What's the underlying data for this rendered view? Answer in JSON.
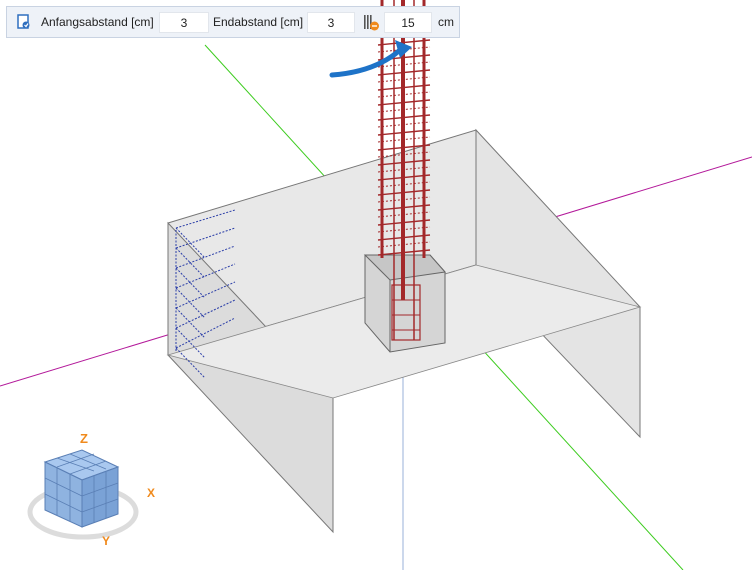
{
  "toolbar": {
    "start_label": "Anfangsabstand [cm]",
    "start_value": "3",
    "end_label": "Endabstand [cm]",
    "end_value": "3",
    "spacing_value": "15",
    "unit_label": "cm",
    "options_icon": "bar-options-icon",
    "spacing_icon": "rebar-spacing-icon"
  },
  "nav_cube": {
    "axis_x": "X",
    "axis_z": "Z",
    "axis_y": "Y"
  },
  "colors": {
    "green_axis": "#3dcc1f",
    "magenta_axis": "#b3199a",
    "rebar": "#a3282a",
    "stirrup_blue": "#2c3fa8",
    "accent_blue": "#1e73c8",
    "cube_orange": "#f08a1c"
  }
}
